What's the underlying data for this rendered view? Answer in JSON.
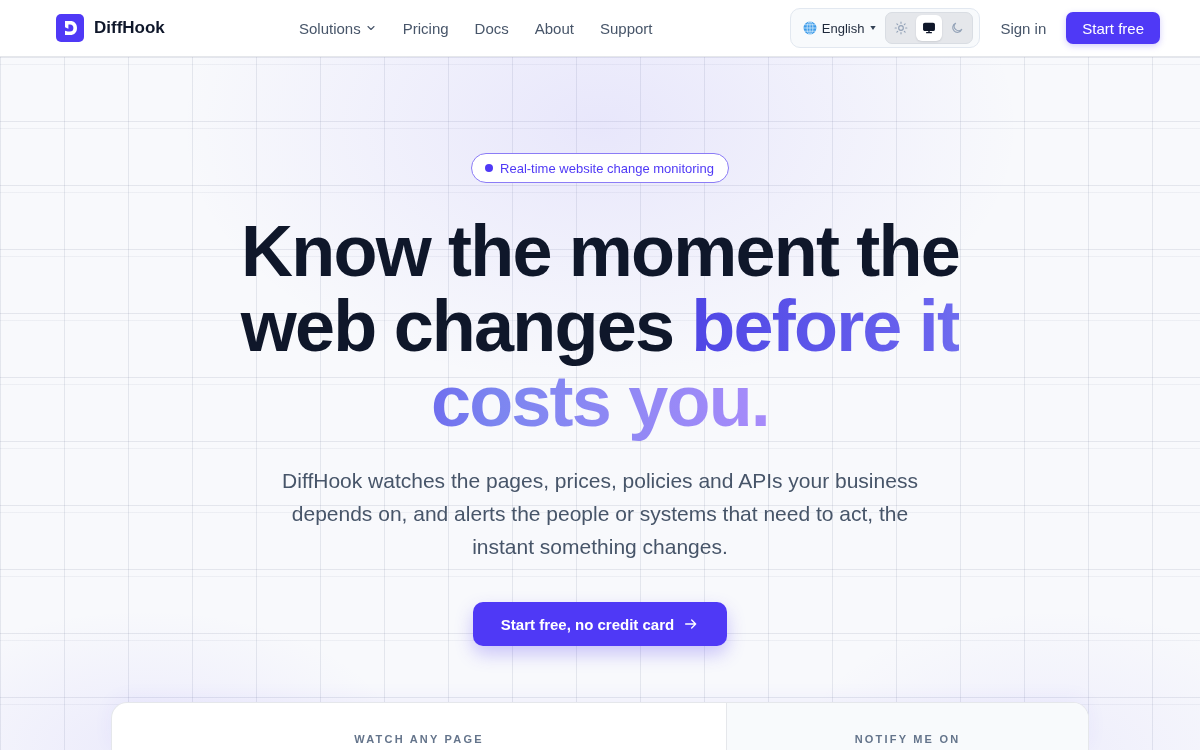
{
  "nav": {
    "brand": "DiffHook",
    "links": [
      {
        "label": "Solutions",
        "kind": "dropdown"
      },
      {
        "label": "Pricing",
        "kind": "link"
      },
      {
        "label": "Docs",
        "kind": "link"
      },
      {
        "label": "About",
        "kind": "link"
      },
      {
        "label": "Support",
        "kind": "link"
      }
    ],
    "language": "English",
    "theme_options": [
      {
        "kind": "light",
        "selected": false
      },
      {
        "kind": "system",
        "selected": true
      },
      {
        "kind": "dark",
        "selected": false
      }
    ],
    "sign_in": "Sign in",
    "start_button": "Start free"
  },
  "hero": {
    "badge": "Real-time website change monitoring",
    "headline": "Know the moment the web changes",
    "headline_accent": "before it costs you.",
    "description": "DiffHook watches the pages, prices, policies and APIs your business depends on, and alerts the people or systems that need to act, the instant something changes.",
    "cta": "Start free, no credit card"
  },
  "panel": {
    "columns": [
      {
        "label": "WATCH ANY PAGE"
      },
      {
        "label": "NOTIFY ME ON"
      }
    ]
  }
}
